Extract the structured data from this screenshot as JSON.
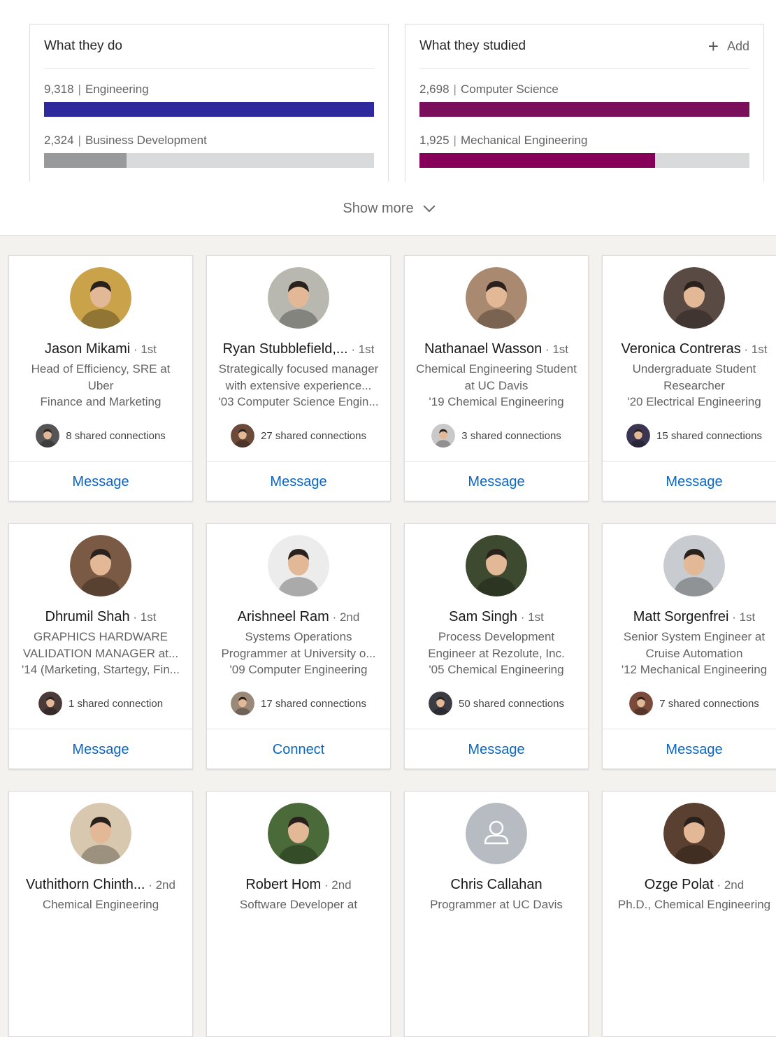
{
  "colors": {
    "engineering_bar": "#2e2a9e",
    "business_bar": "#98999b",
    "cs_bar": "#7a0f5c",
    "mech_bar": "#86005a",
    "bar_track": "#d9dadb",
    "link_blue": "#0a66c2"
  },
  "what_they_do": {
    "title": "What they do",
    "rows": [
      {
        "count": "9,318",
        "label": "Engineering",
        "fraction": 1.0
      },
      {
        "count": "2,324",
        "label": "Business Development",
        "fraction": 0.25
      }
    ]
  },
  "what_they_studied": {
    "title": "What they studied",
    "add_label": "Add",
    "add_icon": "plus-icon",
    "rows": [
      {
        "count": "2,698",
        "label": "Computer Science",
        "fraction": 1.0
      },
      {
        "count": "1,925",
        "label": "Mechanical Engineering",
        "fraction": 0.714
      }
    ]
  },
  "show_more": {
    "label": "Show more",
    "icon": "chevron-down-icon"
  },
  "people": [
    {
      "name": "Jason Mikami",
      "degree": "1st",
      "lines": [
        "Head of Efficiency, SRE at",
        "Uber",
        "Finance and Marketing"
      ],
      "shared": "8 shared connections",
      "action": "Message",
      "avatar": "#c9a24a",
      "mini": "#555555"
    },
    {
      "name": "Ryan Stubblefield,...",
      "degree": "1st",
      "lines": [
        "Strategically focused manager",
        "with extensive experience...",
        "'03 Computer Science Engin..."
      ],
      "shared": "27 shared connections",
      "action": "Message",
      "avatar": "#b8b8b0",
      "mini": "#6b4a3a"
    },
    {
      "name": "Nathanael Wasson",
      "degree": "1st",
      "lines": [
        "Chemical Engineering Student",
        "at UC Davis",
        "'19 Chemical Engineering"
      ],
      "shared": "3 shared connections",
      "action": "Message",
      "avatar": "#a98a70",
      "mini": "#c9c9c9"
    },
    {
      "name": "Veronica Contreras",
      "degree": "1st",
      "lines": [
        "Undergraduate Student",
        "Researcher",
        "'20 Electrical Engineering"
      ],
      "shared": "15 shared connections",
      "action": "Message",
      "avatar": "#5a4a44",
      "mini": "#3a3550"
    },
    {
      "name": "Dhrumil Shah",
      "degree": "1st",
      "lines": [
        "GRAPHICS HARDWARE",
        "VALIDATION MANAGER at...",
        "'14 (Marketing, Startegy, Fin..."
      ],
      "shared": "1 shared connection",
      "action": "Message",
      "avatar": "#7a5a44",
      "mini": "#4a3a3a"
    },
    {
      "name": "Arishneel Ram",
      "degree": "2nd",
      "lines": [
        "Systems Operations",
        "Programmer at University o...",
        "'09 Computer Engineering"
      ],
      "shared": "17 shared connections",
      "action": "Connect",
      "avatar": "#ececec",
      "mini": "#9a8878"
    },
    {
      "name": "Sam Singh",
      "degree": "1st",
      "lines": [
        "Process Development",
        "Engineer at Rezolute, Inc.",
        "'05 Chemical Engineering"
      ],
      "shared": "50 shared connections",
      "action": "Message",
      "avatar": "#3d4a30",
      "mini": "#3c3c44"
    },
    {
      "name": "Matt Sorgenfrei",
      "degree": "1st",
      "lines": [
        "Senior System Engineer at",
        "Cruise Automation",
        "'12 Mechanical Engineering"
      ],
      "shared": "7 shared connections",
      "action": "Message",
      "avatar": "#c8ccd0",
      "mini": "#7a4a3a"
    },
    {
      "name": "Vuthithorn Chinth...",
      "degree": "2nd",
      "lines": [
        "Chemical Engineering"
      ],
      "shared": "",
      "action": "",
      "avatar": "#d8c8b0",
      "mini": ""
    },
    {
      "name": "Robert Hom",
      "degree": "2nd",
      "lines": [
        "Software Developer at"
      ],
      "shared": "",
      "action": "",
      "avatar": "#4a6a3a",
      "mini": ""
    },
    {
      "name": "Chris Callahan",
      "degree": "",
      "lines": [
        "Programmer at UC Davis"
      ],
      "shared": "",
      "action": "",
      "avatar": "#b6bcc1",
      "mini": "",
      "placeholder": true
    },
    {
      "name": "Ozge Polat",
      "degree": "2nd",
      "lines": [
        "Ph.D., Chemical Engineering"
      ],
      "shared": "",
      "action": "",
      "avatar": "#5a4030",
      "mini": ""
    }
  ]
}
